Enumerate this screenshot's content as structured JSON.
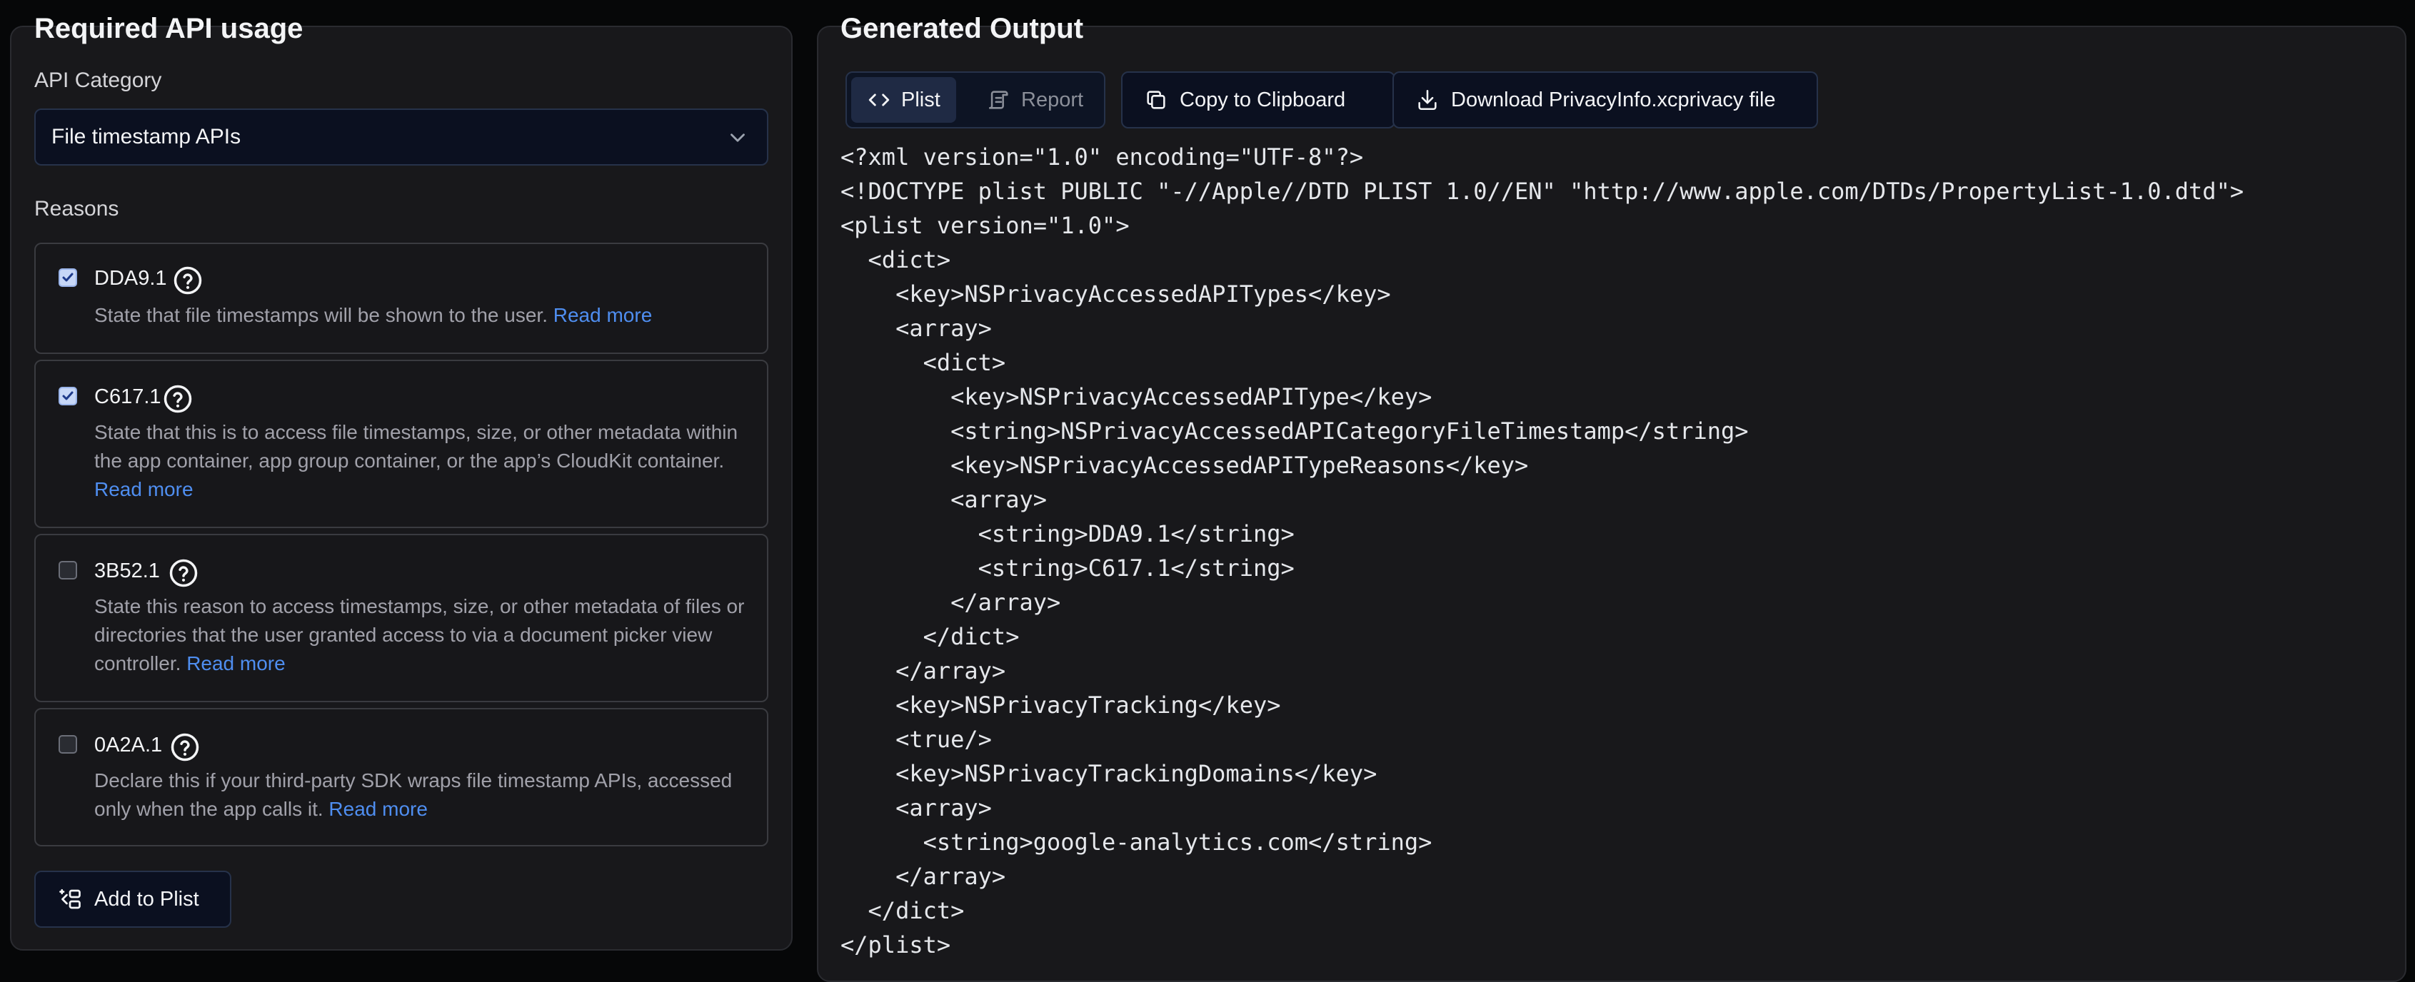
{
  "left_panel": {
    "title": "Required API usage",
    "api_category_label": "API Category",
    "api_category_value": "File timestamp APIs",
    "reasons_label": "Reasons",
    "reasons": [
      {
        "code": "DDA9.1",
        "checked": true,
        "description": "State that file timestamps will be shown to the user.",
        "link": "Read more"
      },
      {
        "code": "C617.1",
        "checked": true,
        "description": "State that this is to access file timestamps, size, or other metadata within the app container, app group container, or the app’s CloudKit container.",
        "link": "Read more"
      },
      {
        "code": "3B52.1",
        "checked": false,
        "description": "State this reason to access timestamps, size, or other metadata of files or directories that the user granted access to via a document picker view controller.",
        "link": "Read more"
      },
      {
        "code": "0A2A.1",
        "checked": false,
        "description": "Declare this if your third-party SDK wraps file timestamp APIs, accessed only when the app calls it.",
        "link": "Read more"
      }
    ],
    "add_button": "Add to Plist"
  },
  "right_panel": {
    "title": "Generated Output",
    "tabs": [
      {
        "label": "Plist",
        "icon": "code-icon",
        "active": true
      },
      {
        "label": "Report",
        "icon": "scroll-icon",
        "active": false
      }
    ],
    "copy_button": "Copy to Clipboard",
    "download_button": "Download PrivacyInfo.xcprivacy file",
    "code_lines": [
      "<?xml version=\"1.0\" encoding=\"UTF-8\"?>",
      "<!DOCTYPE plist PUBLIC \"-//Apple//DTD PLIST 1.0//EN\" \"http://www.apple.com/DTDs/PropertyList-1.0.dtd\">",
      "<plist version=\"1.0\">",
      "  <dict>",
      "    <key>NSPrivacyAccessedAPITypes</key>",
      "    <array>",
      "      <dict>",
      "        <key>NSPrivacyAccessedAPIType</key>",
      "        <string>NSPrivacyAccessedAPICategoryFileTimestamp</string>",
      "        <key>NSPrivacyAccessedAPITypeReasons</key>",
      "        <array>",
      "          <string>DDA9.1</string>",
      "          <string>C617.1</string>",
      "        </array>",
      "      </dict>",
      "    </array>",
      "    <key>NSPrivacyTracking</key>",
      "    <true/>",
      "    <key>NSPrivacyTrackingDomains</key>",
      "    <array>",
      "      <string>google-analytics.com</string>",
      "    </array>",
      "  </dict>",
      "</plist>"
    ]
  },
  "colors": {
    "page_background": "#060708",
    "panel_background": "#18181b",
    "link": "#4f8ef0",
    "checkbox_checked": "#c7d7f7"
  }
}
